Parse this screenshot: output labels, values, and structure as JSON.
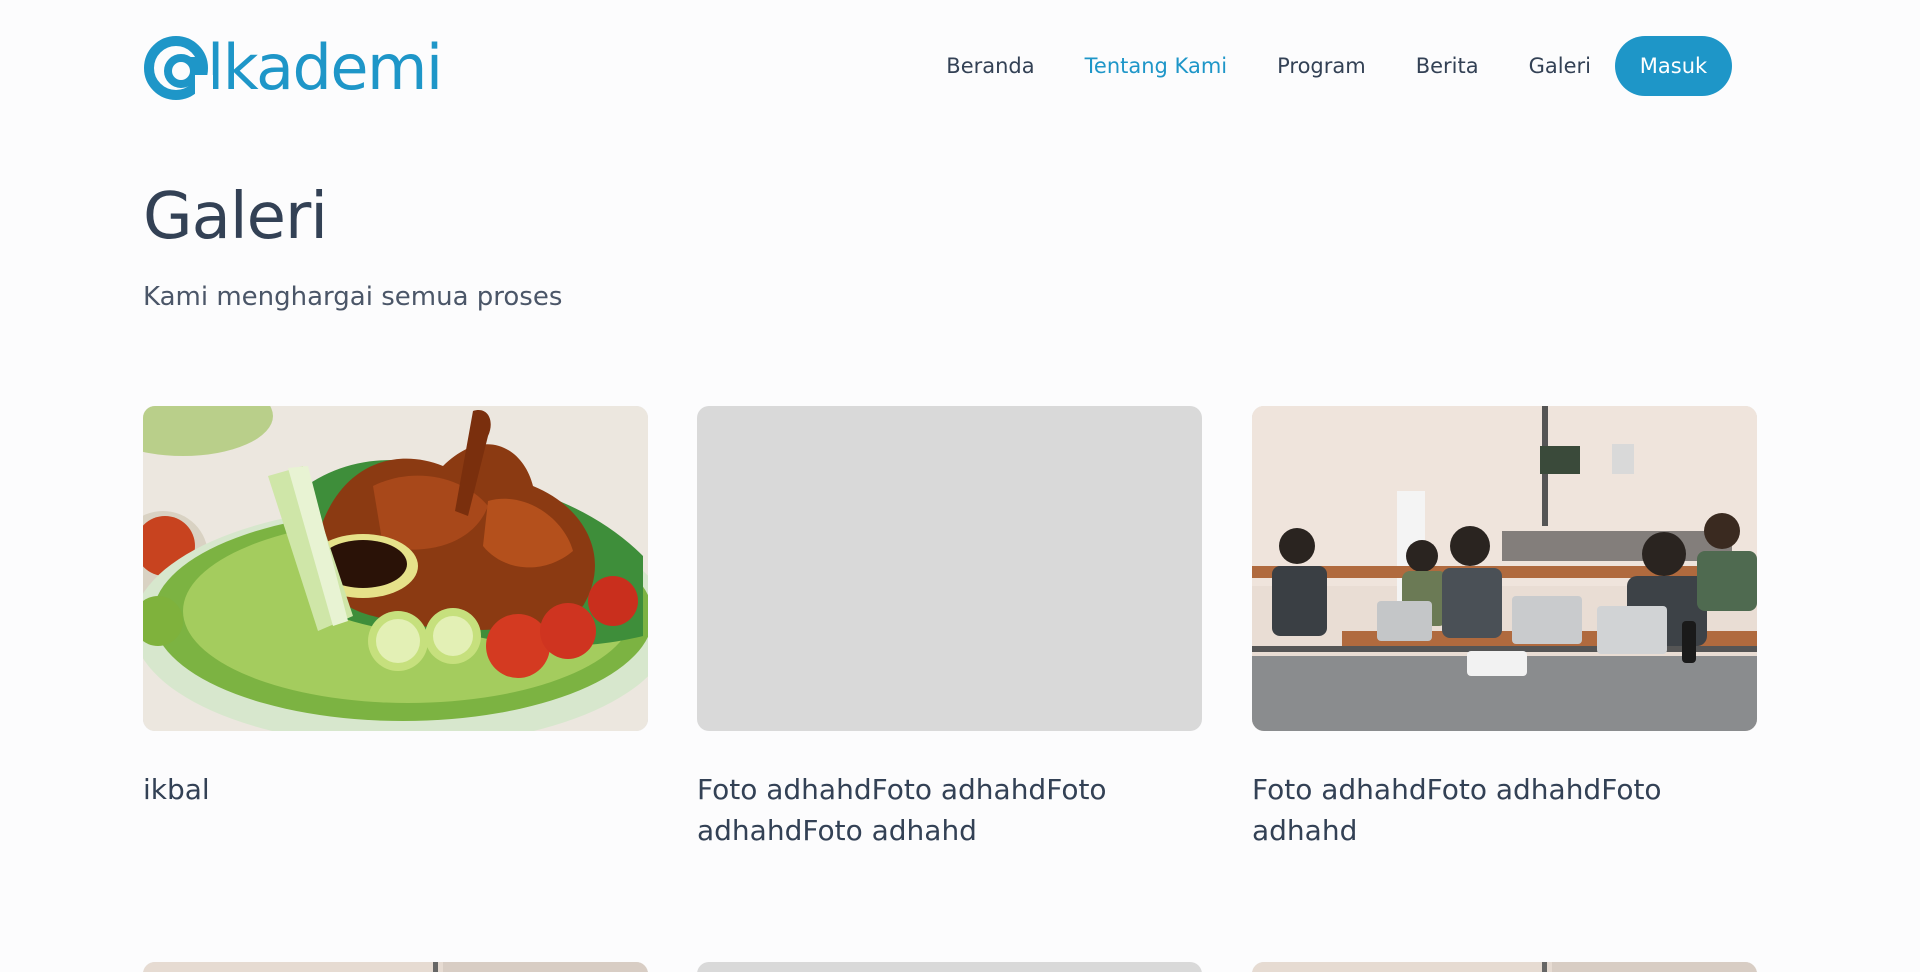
{
  "brand": {
    "logo_text": "lkademi"
  },
  "nav": {
    "items": [
      {
        "label": "Beranda",
        "active": false
      },
      {
        "label": "Tentang Kami",
        "active": true
      },
      {
        "label": "Program",
        "active": false
      },
      {
        "label": "Berita",
        "active": false
      },
      {
        "label": "Galeri",
        "active": false
      }
    ],
    "login_label": "Masuk"
  },
  "page": {
    "title": "Galeri",
    "subtitle": "Kami menghargai semua proses"
  },
  "gallery": {
    "cards": [
      {
        "title": "ikbal",
        "image": "grilled-chicken-plate"
      },
      {
        "title": "Foto adhahdFoto adhahdFoto adhahdFoto adhahd",
        "image": "placeholder-gray"
      },
      {
        "title": "Foto adhahdFoto adhahdFoto adhahd",
        "image": "classroom-students-laptops"
      }
    ]
  },
  "colors": {
    "accent": "#1e96c8",
    "text": "#334155",
    "placeholder": "#d9d9d9",
    "background": "#fcfcfd"
  }
}
